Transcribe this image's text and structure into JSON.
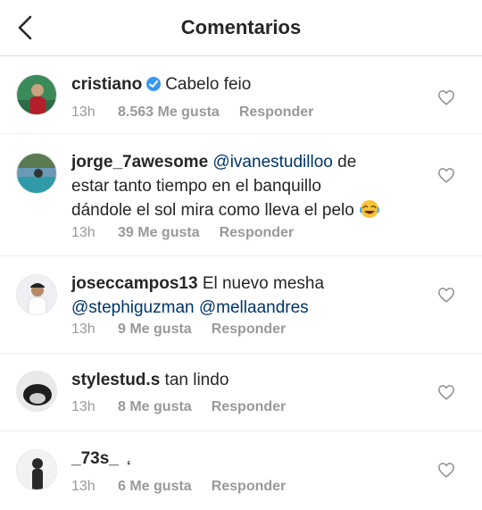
{
  "header": {
    "title": "Comentarios",
    "back_icon": "chevron-left-icon"
  },
  "colors": {
    "mention": "#003569",
    "meta": "#999999",
    "verified": "#3897f0"
  },
  "comments": [
    {
      "username": "cristiano",
      "verified": true,
      "text": "Cabelo feio",
      "time": "13h",
      "likes": "8.563 Me gusta",
      "reply": "Responder"
    },
    {
      "username": "jorge_7awesome",
      "mention": "@ivanestudilloo",
      "text_part1": " de",
      "text_line2": "estar tanto tiempo en el banquillo",
      "text_line3": "dándole el sol mira como lleva el pelo",
      "emoji": "face-with-tears-of-joy",
      "time": "13h",
      "likes": "39 Me gusta",
      "reply": "Responder"
    },
    {
      "username": "joseccampos13",
      "text": "El nuevo mesha",
      "mention1": "@stephiguzman",
      "mention2": "@mellaandres",
      "time": "13h",
      "likes": "9 Me gusta",
      "reply": "Responder"
    },
    {
      "username": "stylestud.s",
      "text": "tan lindo",
      "time": "13h",
      "likes": "8 Me gusta",
      "reply": "Responder"
    },
    {
      "username": "_73s_",
      "text": "‬",
      "time": "13h",
      "likes": "6 Me gusta",
      "reply": "Responder"
    }
  ]
}
